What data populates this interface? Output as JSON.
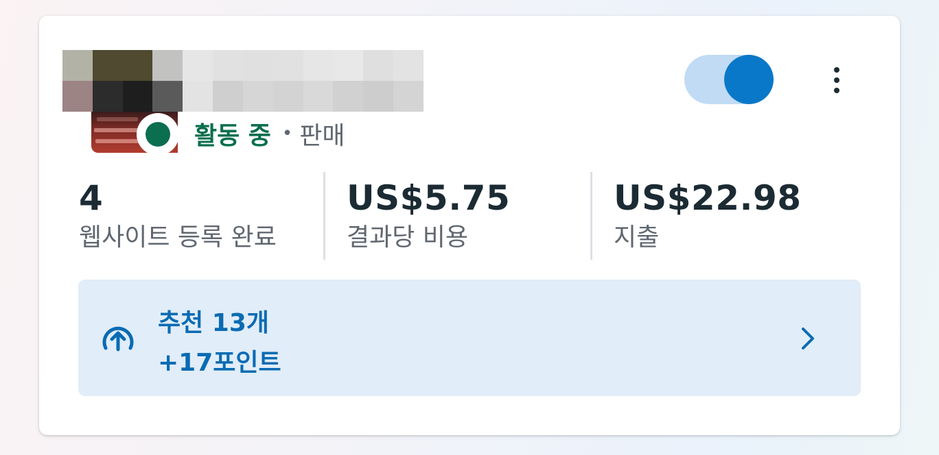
{
  "campaign": {
    "status": "활동 중",
    "separator": "•",
    "objective": "판매",
    "toggle_on": true
  },
  "metrics": [
    {
      "value": "4",
      "label": "웹사이트 등록 완료"
    },
    {
      "value": "US$5.75",
      "label": "결과당 비용"
    },
    {
      "value": "US$22.98",
      "label": "지출"
    }
  ],
  "recommendations": {
    "title": "추천 13개",
    "points": "+17포인트"
  },
  "colors": {
    "active_green": "#0b6e4f",
    "accent_blue": "#0a78c8",
    "banner_bg": "#e1edf8"
  },
  "icons": {
    "more": "more-vertical-icon",
    "reco": "arrow-up-circle-icon",
    "chevron": "chevron-right-icon"
  }
}
